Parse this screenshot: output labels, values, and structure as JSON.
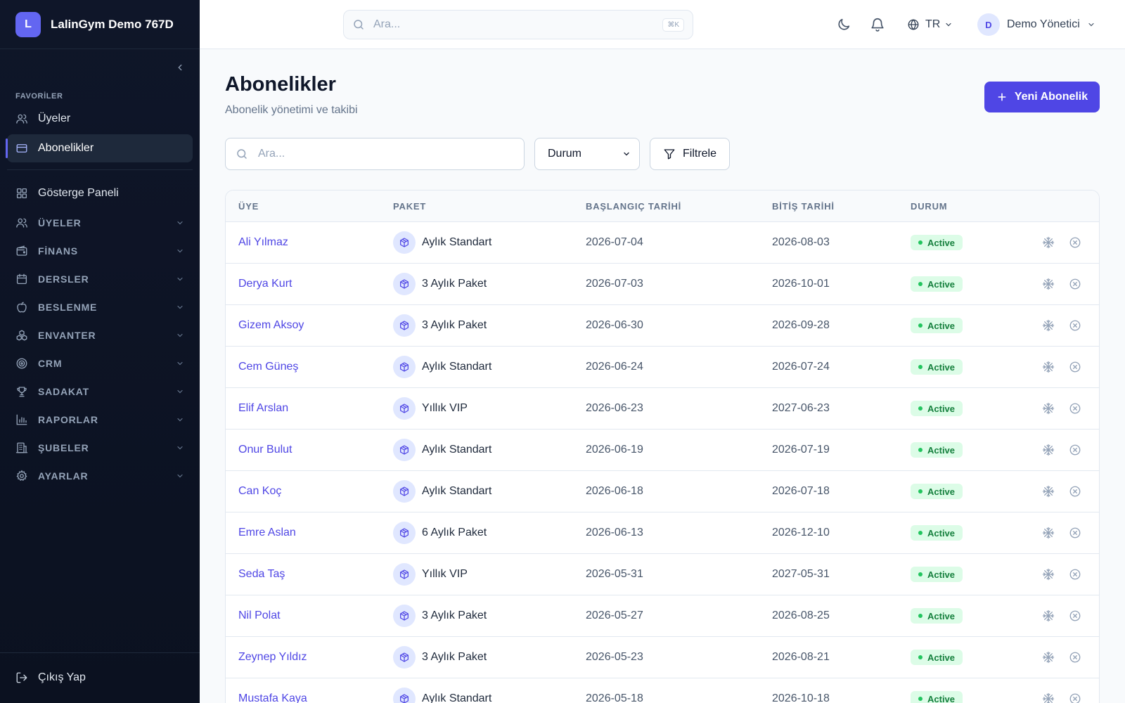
{
  "brand": {
    "initial": "L",
    "name": "LalinGym Demo 767D"
  },
  "sidebar": {
    "favorites_label": "FAVORİLER",
    "favorites": [
      {
        "label": "Üyeler",
        "icon": "users-icon"
      },
      {
        "label": "Abonelikler",
        "icon": "card-icon",
        "active": true
      }
    ],
    "dashboard": {
      "label": "Gösterge Paneli",
      "icon": "grid-icon"
    },
    "groups": [
      {
        "label": "ÜYELER",
        "icon": "users-icon"
      },
      {
        "label": "FİNANS",
        "icon": "wallet-icon"
      },
      {
        "label": "DERSLER",
        "icon": "calendar-icon"
      },
      {
        "label": "BESLENME",
        "icon": "apple-icon"
      },
      {
        "label": "ENVANTER",
        "icon": "boxes-icon"
      },
      {
        "label": "CRM",
        "icon": "target-icon"
      },
      {
        "label": "SADAKAT",
        "icon": "trophy-icon"
      },
      {
        "label": "RAPORLAR",
        "icon": "bar-chart-icon"
      },
      {
        "label": "ŞUBELER",
        "icon": "building-icon"
      },
      {
        "label": "AYARLAR",
        "icon": "gear-icon"
      }
    ],
    "logout": "Çıkış Yap"
  },
  "topbar": {
    "search_placeholder": "Ara...",
    "shortcut": "⌘K",
    "language": "TR",
    "user_initial": "D",
    "user_name": "Demo Yönetici"
  },
  "page": {
    "title": "Abonelikler",
    "subtitle": "Abonelik yönetimi ve takibi",
    "new_button": "Yeni Abonelik"
  },
  "filters": {
    "search_placeholder": "Ara...",
    "status_value": "Durum",
    "filter_button": "Filtrele"
  },
  "table": {
    "headers": [
      "ÜYE",
      "PAKET",
      "BAŞLANGIÇ TARİHİ",
      "BİTİŞ TARİHİ",
      "DURUM"
    ],
    "rows": [
      {
        "member": "Ali Yılmaz",
        "package": "Aylık Standart",
        "start": "2026-07-04",
        "end": "2026-08-03",
        "status": "Active"
      },
      {
        "member": "Derya Kurt",
        "package": "3 Aylık Paket",
        "start": "2026-07-03",
        "end": "2026-10-01",
        "status": "Active"
      },
      {
        "member": "Gizem Aksoy",
        "package": "3 Aylık Paket",
        "start": "2026-06-30",
        "end": "2026-09-28",
        "status": "Active"
      },
      {
        "member": "Cem Güneş",
        "package": "Aylık Standart",
        "start": "2026-06-24",
        "end": "2026-07-24",
        "status": "Active"
      },
      {
        "member": "Elif Arslan",
        "package": "Yıllık VIP",
        "start": "2026-06-23",
        "end": "2027-06-23",
        "status": "Active"
      },
      {
        "member": "Onur Bulut",
        "package": "Aylık Standart",
        "start": "2026-06-19",
        "end": "2026-07-19",
        "status": "Active"
      },
      {
        "member": "Can Koç",
        "package": "Aylık Standart",
        "start": "2026-06-18",
        "end": "2026-07-18",
        "status": "Active"
      },
      {
        "member": "Emre Aslan",
        "package": "6 Aylık Paket",
        "start": "2026-06-13",
        "end": "2026-12-10",
        "status": "Active"
      },
      {
        "member": "Seda Taş",
        "package": "Yıllık VIP",
        "start": "2026-05-31",
        "end": "2027-05-31",
        "status": "Active"
      },
      {
        "member": "Nil Polat",
        "package": "3 Aylık Paket",
        "start": "2026-05-27",
        "end": "2026-08-25",
        "status": "Active"
      },
      {
        "member": "Zeynep Yıldız",
        "package": "3 Aylık Paket",
        "start": "2026-05-23",
        "end": "2026-08-21",
        "status": "Active"
      },
      {
        "member": "Mustafa Kaya",
        "package": "Aylık Standart",
        "start": "2026-05-18",
        "end": "2026-10-18",
        "status": "Active"
      }
    ]
  },
  "colors": {
    "accent": "#4f46e5",
    "sidebar_bg": "#0f1629",
    "active_badge_bg": "#dcfce7",
    "active_badge_text": "#15803d"
  }
}
